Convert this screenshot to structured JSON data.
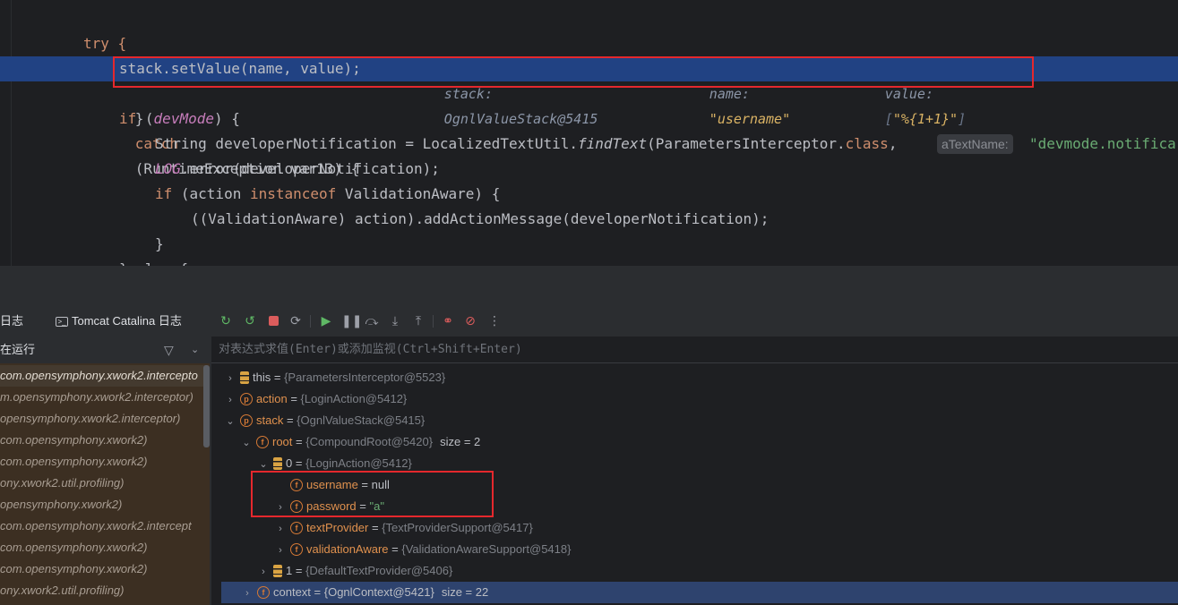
{
  "editor": {
    "line_try": "try {",
    "exec_line": {
      "code": "stack.setValue(name, value);",
      "hint_stack_label": "stack:",
      "hint_stack_value": "OgnlValueStack@5415",
      "hint_name_label": "name:",
      "hint_name_value": "\"username\"",
      "hint_value_label": "value:",
      "hint_value_open": "[",
      "hint_value_value": "\"%{1+1}\"",
      "hint_value_close": "]"
    },
    "catch_brace": "}",
    "catch_kw": "catch",
    "catch_rest": "(RuntimeException var13) {",
    "if_kw": "if",
    "if_open": "(",
    "if_var": "devMode",
    "if_close": ") {",
    "line_dev_1": "String developerNotification = LocalizedTextUtil.",
    "line_dev_method": "findText",
    "line_dev_2": "(ParametersInterceptor.",
    "line_dev_class_kw": "class",
    "line_dev_3": ", ",
    "inlay_hint": "aTextName:",
    "line_dev_str": "\"devmode.notifica",
    "log_field": "LOG",
    "log_rest": ".error(developerNotification);",
    "if2_kw": "if",
    "if2_a": " (action ",
    "if2_instanceof": "instanceof",
    "if2_b": " ValidationAware) {",
    "add_msg": "((ValidationAware) action).addActionMessage(developerNotification);",
    "close_brace": "}",
    "cut_line": "} else {"
  },
  "tabs": {
    "log_tab": "日志",
    "catalina_tab": "Tomcat Catalina 日志"
  },
  "toolbar": {
    "icons": [
      "rerun-icon",
      "restart-icon",
      "stop-icon",
      "refresh-icon",
      "resume-icon",
      "pause-icon",
      "step-over-icon",
      "step-into-icon",
      "step-out-icon",
      "view-breakpoints-icon",
      "mute-breakpoints-icon",
      "more-icon"
    ]
  },
  "frames": {
    "header": "在运行",
    "items": [
      "com.opensymphony.xwork2.intercepto",
      "m.opensymphony.xwork2.interceptor)",
      "opensymphony.xwork2.interceptor)",
      "com.opensymphony.xwork2)",
      "com.opensymphony.xwork2)",
      "ony.xwork2.util.profiling)",
      "opensymphony.xwork2)",
      "com.opensymphony.xwork2.intercept",
      "com.opensymphony.xwork2)",
      "com.opensymphony.xwork2)",
      "ony.xwork2.util.profiling)"
    ]
  },
  "evaluator": {
    "placeholder": "对表达式求值(Enter)或添加监视(Ctrl+Shift+Enter)"
  },
  "variables": [
    {
      "name": "this",
      "eq": " = ",
      "type": "{ParametersInterceptor@5523}"
    },
    {
      "name": "action",
      "eq": " = ",
      "type": "{LoginAction@5412}"
    },
    {
      "name": "stack",
      "eq": " = ",
      "type": "{OgnlValueStack@5415}"
    },
    {
      "name": "root",
      "eq": " = ",
      "type": "{CompoundRoot@5420}",
      "size": "size = 2"
    },
    {
      "name": "0",
      "eq": " = ",
      "type": "{LoginAction@5412}"
    },
    {
      "name": "username",
      "eq": " = ",
      "value": "null"
    },
    {
      "name": "password",
      "eq": " = ",
      "value": "\"a\""
    },
    {
      "name": "textProvider",
      "eq": " = ",
      "type": "{TextProviderSupport@5417}"
    },
    {
      "name": "validationAware",
      "eq": " = ",
      "type": "{ValidationAwareSupport@5418}"
    },
    {
      "name": "1",
      "eq": " = ",
      "type": "{DefaultTextProvider@5406}"
    },
    {
      "name": "context",
      "eq": " = ",
      "value": "{OgnlContext@5421}",
      "size": "size = 22"
    }
  ]
}
